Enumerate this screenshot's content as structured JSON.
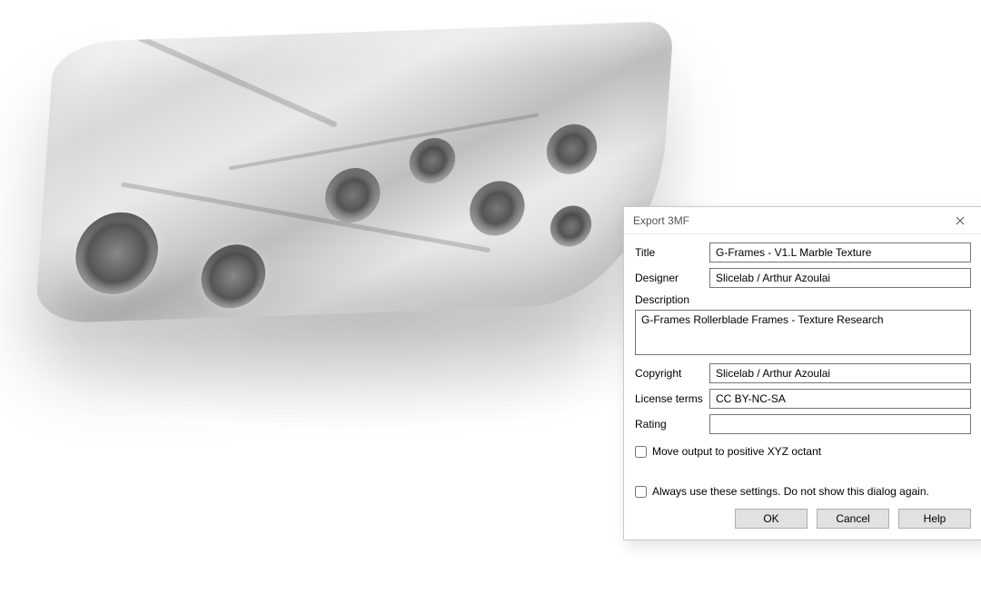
{
  "dialog": {
    "window_title": "Export 3MF",
    "labels": {
      "title": "Title",
      "designer": "Designer",
      "description": "Description",
      "copyright": "Copyright",
      "license": "License terms",
      "rating": "Rating"
    },
    "values": {
      "title": "G-Frames - V1.L Marble Texture",
      "designer": "Slicelab / Arthur Azoulai",
      "description": "G-Frames Rollerblade Frames - Texture Research",
      "copyright": "Slicelab / Arthur Azoulai",
      "license": "CC BY-NC-SA",
      "rating": ""
    },
    "checkboxes": {
      "move_output": "Move output to positive XYZ octant",
      "always_use": "Always use these settings. Do not show this dialog again."
    },
    "buttons": {
      "ok": "OK",
      "cancel": "Cancel",
      "help": "Help"
    }
  }
}
